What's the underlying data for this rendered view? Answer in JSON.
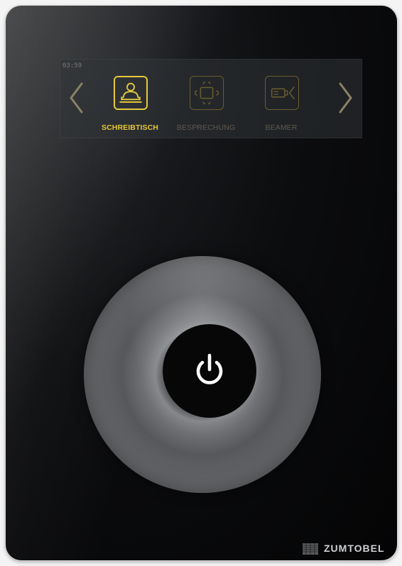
{
  "device": {
    "clock": "03:59",
    "modes": [
      {
        "label": "SCHREIBTISCH",
        "icon": "desk-person-icon",
        "active": true
      },
      {
        "label": "BESPRECHUNG",
        "icon": "meeting-table-icon",
        "active": false
      },
      {
        "label": "BEAMER",
        "icon": "projector-icon",
        "active": false
      }
    ],
    "nav": {
      "prev_icon": "chevron-left-icon",
      "next_icon": "chevron-right-icon"
    },
    "power": {
      "icon": "power-icon"
    },
    "brand": {
      "name": "ZUMTOBEL",
      "logo_icon": "zumtobel-grid-logo"
    }
  },
  "colors": {
    "accent": "#e7c832",
    "inactive_accent": "#6a5d2e",
    "panel": "#0a0b0d",
    "power_glyph": "#ffffff"
  }
}
